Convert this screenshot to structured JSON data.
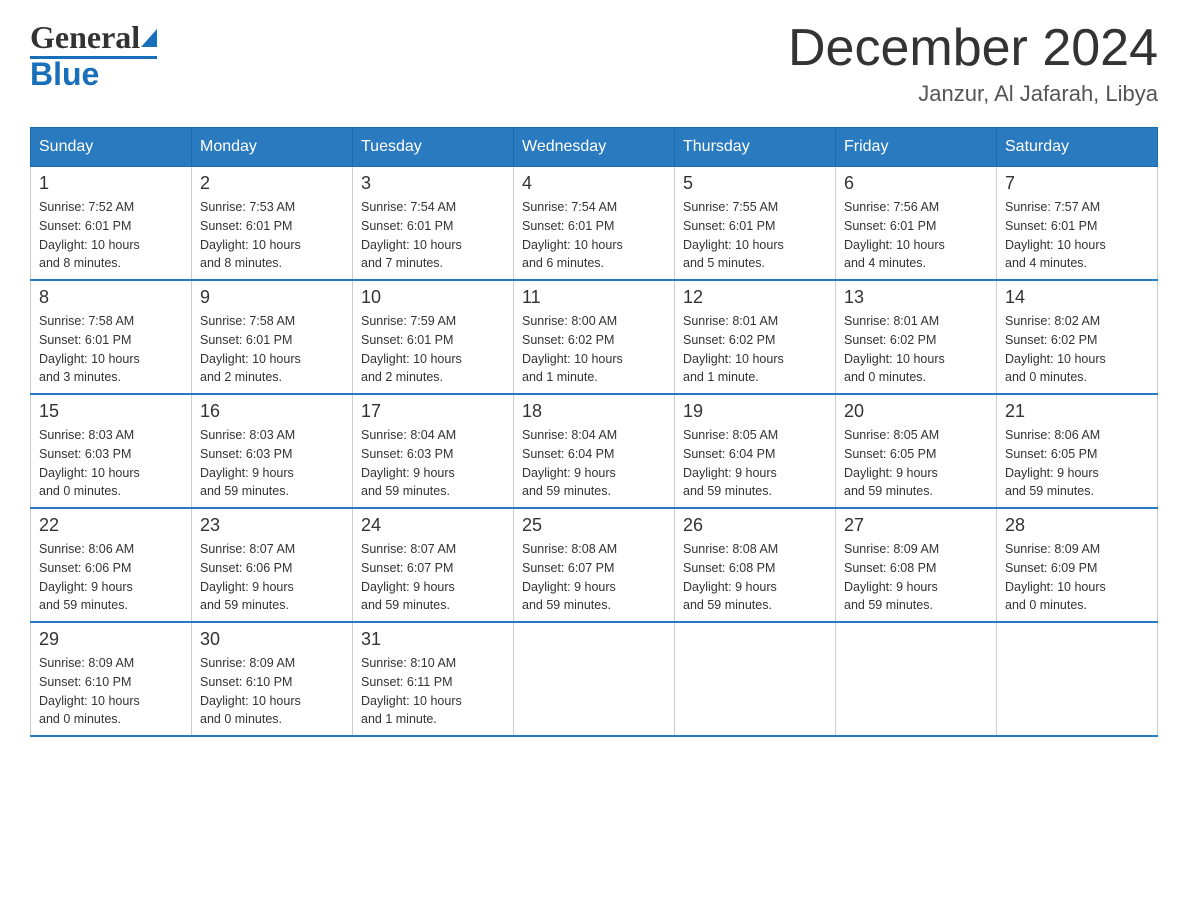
{
  "header": {
    "logo_general": "General",
    "logo_blue": "Blue",
    "month_title": "December 2024",
    "location": "Janzur, Al Jafarah, Libya"
  },
  "days_of_week": [
    "Sunday",
    "Monday",
    "Tuesday",
    "Wednesday",
    "Thursday",
    "Friday",
    "Saturday"
  ],
  "weeks": [
    [
      {
        "day": "1",
        "sunrise": "7:52 AM",
        "sunset": "6:01 PM",
        "daylight": "10 hours and 8 minutes."
      },
      {
        "day": "2",
        "sunrise": "7:53 AM",
        "sunset": "6:01 PM",
        "daylight": "10 hours and 8 minutes."
      },
      {
        "day": "3",
        "sunrise": "7:54 AM",
        "sunset": "6:01 PM",
        "daylight": "10 hours and 7 minutes."
      },
      {
        "day": "4",
        "sunrise": "7:54 AM",
        "sunset": "6:01 PM",
        "daylight": "10 hours and 6 minutes."
      },
      {
        "day": "5",
        "sunrise": "7:55 AM",
        "sunset": "6:01 PM",
        "daylight": "10 hours and 5 minutes."
      },
      {
        "day": "6",
        "sunrise": "7:56 AM",
        "sunset": "6:01 PM",
        "daylight": "10 hours and 4 minutes."
      },
      {
        "day": "7",
        "sunrise": "7:57 AM",
        "sunset": "6:01 PM",
        "daylight": "10 hours and 4 minutes."
      }
    ],
    [
      {
        "day": "8",
        "sunrise": "7:58 AM",
        "sunset": "6:01 PM",
        "daylight": "10 hours and 3 minutes."
      },
      {
        "day": "9",
        "sunrise": "7:58 AM",
        "sunset": "6:01 PM",
        "daylight": "10 hours and 2 minutes."
      },
      {
        "day": "10",
        "sunrise": "7:59 AM",
        "sunset": "6:01 PM",
        "daylight": "10 hours and 2 minutes."
      },
      {
        "day": "11",
        "sunrise": "8:00 AM",
        "sunset": "6:02 PM",
        "daylight": "10 hours and 1 minute."
      },
      {
        "day": "12",
        "sunrise": "8:01 AM",
        "sunset": "6:02 PM",
        "daylight": "10 hours and 1 minute."
      },
      {
        "day": "13",
        "sunrise": "8:01 AM",
        "sunset": "6:02 PM",
        "daylight": "10 hours and 0 minutes."
      },
      {
        "day": "14",
        "sunrise": "8:02 AM",
        "sunset": "6:02 PM",
        "daylight": "10 hours and 0 minutes."
      }
    ],
    [
      {
        "day": "15",
        "sunrise": "8:03 AM",
        "sunset": "6:03 PM",
        "daylight": "10 hours and 0 minutes."
      },
      {
        "day": "16",
        "sunrise": "8:03 AM",
        "sunset": "6:03 PM",
        "daylight": "9 hours and 59 minutes."
      },
      {
        "day": "17",
        "sunrise": "8:04 AM",
        "sunset": "6:03 PM",
        "daylight": "9 hours and 59 minutes."
      },
      {
        "day": "18",
        "sunrise": "8:04 AM",
        "sunset": "6:04 PM",
        "daylight": "9 hours and 59 minutes."
      },
      {
        "day": "19",
        "sunrise": "8:05 AM",
        "sunset": "6:04 PM",
        "daylight": "9 hours and 59 minutes."
      },
      {
        "day": "20",
        "sunrise": "8:05 AM",
        "sunset": "6:05 PM",
        "daylight": "9 hours and 59 minutes."
      },
      {
        "day": "21",
        "sunrise": "8:06 AM",
        "sunset": "6:05 PM",
        "daylight": "9 hours and 59 minutes."
      }
    ],
    [
      {
        "day": "22",
        "sunrise": "8:06 AM",
        "sunset": "6:06 PM",
        "daylight": "9 hours and 59 minutes."
      },
      {
        "day": "23",
        "sunrise": "8:07 AM",
        "sunset": "6:06 PM",
        "daylight": "9 hours and 59 minutes."
      },
      {
        "day": "24",
        "sunrise": "8:07 AM",
        "sunset": "6:07 PM",
        "daylight": "9 hours and 59 minutes."
      },
      {
        "day": "25",
        "sunrise": "8:08 AM",
        "sunset": "6:07 PM",
        "daylight": "9 hours and 59 minutes."
      },
      {
        "day": "26",
        "sunrise": "8:08 AM",
        "sunset": "6:08 PM",
        "daylight": "9 hours and 59 minutes."
      },
      {
        "day": "27",
        "sunrise": "8:09 AM",
        "sunset": "6:08 PM",
        "daylight": "9 hours and 59 minutes."
      },
      {
        "day": "28",
        "sunrise": "8:09 AM",
        "sunset": "6:09 PM",
        "daylight": "10 hours and 0 minutes."
      }
    ],
    [
      {
        "day": "29",
        "sunrise": "8:09 AM",
        "sunset": "6:10 PM",
        "daylight": "10 hours and 0 minutes."
      },
      {
        "day": "30",
        "sunrise": "8:09 AM",
        "sunset": "6:10 PM",
        "daylight": "10 hours and 0 minutes."
      },
      {
        "day": "31",
        "sunrise": "8:10 AM",
        "sunset": "6:11 PM",
        "daylight": "10 hours and 1 minute."
      },
      null,
      null,
      null,
      null
    ]
  ],
  "labels": {
    "sunrise": "Sunrise:",
    "sunset": "Sunset:",
    "daylight": "Daylight:"
  }
}
